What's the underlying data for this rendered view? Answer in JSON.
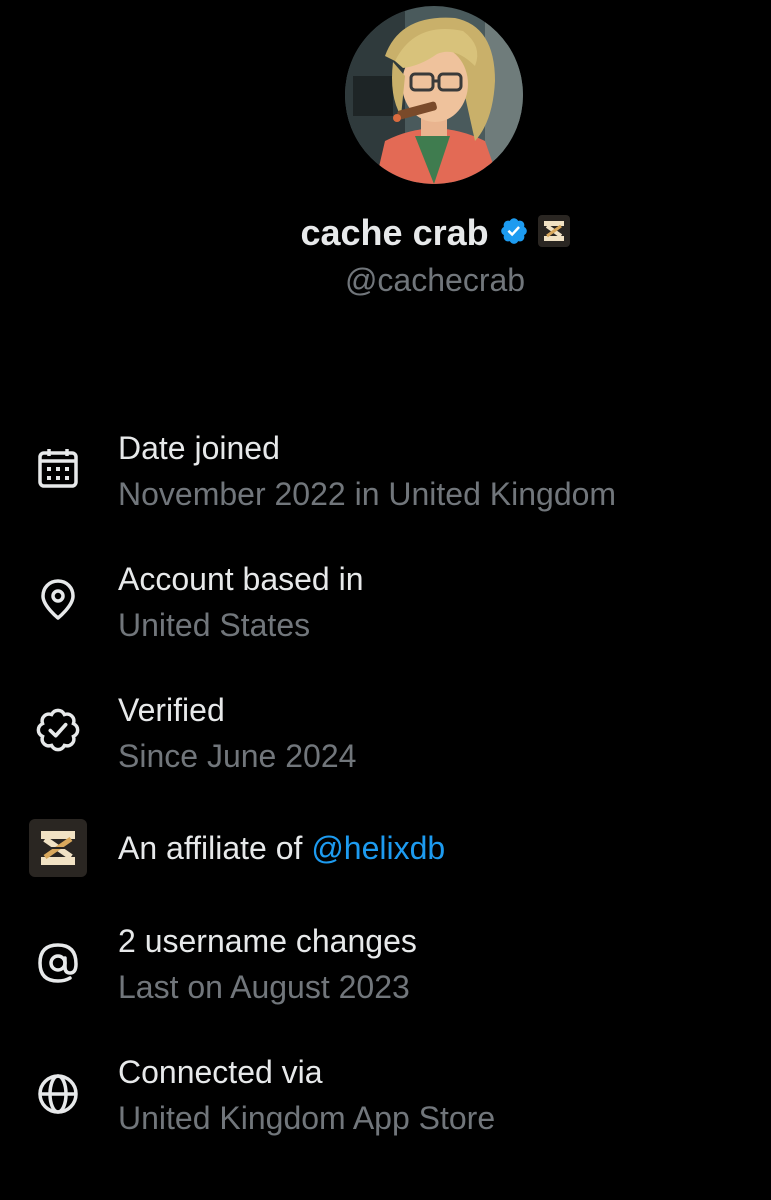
{
  "profile": {
    "display_name": "cache crab",
    "handle": "@cachecrab",
    "avatar_description": "avatar",
    "verified": true
  },
  "colors": {
    "background": "#000000",
    "primary_text": "#e7e9ea",
    "secondary_text": "#71767b",
    "link": "#1d9bf0",
    "verified_badge": "#1d9bf0"
  },
  "info": {
    "date_joined": {
      "icon": "calendar-icon",
      "title": "Date joined",
      "value": "November 2022 in United Kingdom"
    },
    "account_based": {
      "icon": "location-pin-icon",
      "title": "Account based in",
      "value": "United States"
    },
    "verified": {
      "icon": "verified-badge-icon",
      "title": "Verified",
      "value": "Since June 2024"
    },
    "affiliate": {
      "icon": "helixdb-logo-icon",
      "title_prefix": "An affiliate of ",
      "link": "@helixdb"
    },
    "username_changes": {
      "icon": "at-sign-icon",
      "title": "2 username changes",
      "value": "Last on August 2023"
    },
    "connected_via": {
      "icon": "globe-icon",
      "title": "Connected via",
      "value": "United Kingdom App Store"
    }
  }
}
